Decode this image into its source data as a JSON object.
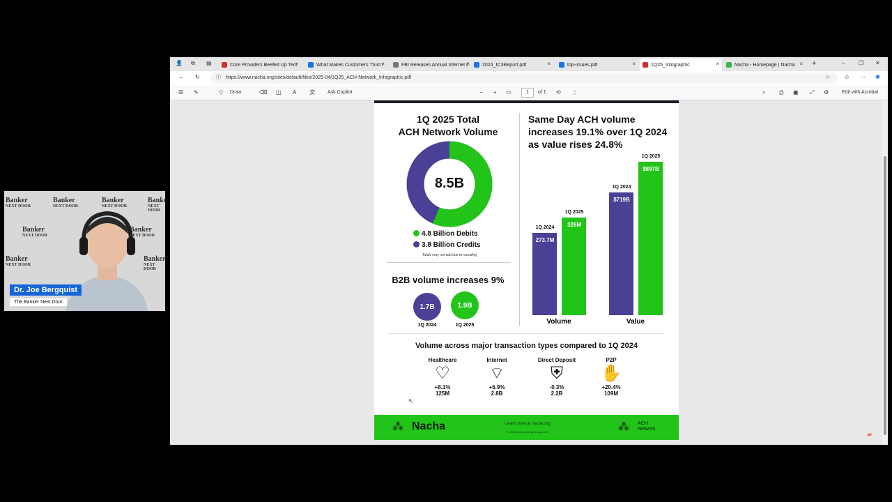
{
  "browser": {
    "tabs": [
      {
        "label": "Core Providers Beefed Up Tech",
        "color": "#d32f2f"
      },
      {
        "label": "What Makes Customers Trust O",
        "color": "#1a73e8"
      },
      {
        "label": "FBI Releases Annual Internet C",
        "color": "#777777"
      },
      {
        "label": "2024_IC3Report.pdf",
        "color": "#1a73e8"
      },
      {
        "label": "top-issues.pdf",
        "color": "#1a73e8"
      },
      {
        "label": "1Q25_Infographic",
        "color": "#d32f2f"
      },
      {
        "label": "Nacha - Homepage | Nacha",
        "color": "#3bb54a"
      }
    ],
    "url": "https://www.nacha.org/sites/default/files/2025-04/1Q25_ACH-Network_Infographic.pdf"
  },
  "pdf_toolbar": {
    "draw": "Draw",
    "ask_copilot": "Ask Copilot",
    "page_current": "1",
    "page_total": "of 1",
    "edit_acrobat": "Edit with Acrobat"
  },
  "infographic": {
    "total_title_1": "1Q 2025 Total",
    "total_title_2": "ACH Network Volume",
    "total_value": "8.5B",
    "debits": "4.8 Billion Debits",
    "credits": "3.8 Billion Credits",
    "rounding_note": "Totals may not add due to rounding",
    "b2b_title": "B2B volume increases 9%",
    "b2b_2024_value": "1.7B",
    "b2b_2024_label": "1Q 2024",
    "b2b_2025_value": "1.9B",
    "b2b_2025_label": "1Q 2025",
    "sameday_title_1": "Same Day ACH volume",
    "sameday_title_2": "increases 19.1% over 1Q 2024",
    "sameday_title_3": "as value rises 24.8%",
    "txn_title": "Volume across major transaction types compared to 1Q 2024",
    "txn": [
      {
        "name": "Healthcare",
        "change": "+8.1%",
        "volume": "125M"
      },
      {
        "name": "Internet",
        "change": "+6.9%",
        "volume": "2.8B"
      },
      {
        "name": "Direct Deposit",
        "change": "-0.3%",
        "volume": "2.2B"
      },
      {
        "name": "P2P",
        "change": "+20.4%",
        "volume": "109M"
      }
    ],
    "footer_brand": "Nacha",
    "footer_link": "Learn more at nacha.org",
    "footer_copyright": "© 2025 Nacha. All rights reserved.",
    "footer_ach_1": "ACH",
    "footer_ach_2": "Network",
    "colors": {
      "purple": "#4a4096",
      "green": "#22c41a"
    }
  },
  "chart_data": {
    "type": "bar",
    "title": "Same Day ACH volume increases 19.1% over 1Q 2024 as value rises 24.8%",
    "categories": [
      "Volume",
      "Value"
    ],
    "series": [
      {
        "name": "1Q 2024",
        "values": [
          273.7,
          719
        ],
        "labels": [
          "273.7M",
          "$719B"
        ]
      },
      {
        "name": "1Q 2025",
        "values": [
          326,
          897
        ],
        "labels": [
          "326M",
          "$897B"
        ]
      }
    ],
    "value_units": [
      "M",
      "$B"
    ]
  },
  "webcam": {
    "presenter_name": "Dr. Joe Bergquist",
    "show_name": "The Banker Next Door",
    "logo_line1": "Banker",
    "logo_line2": "NEXT DOOR"
  }
}
